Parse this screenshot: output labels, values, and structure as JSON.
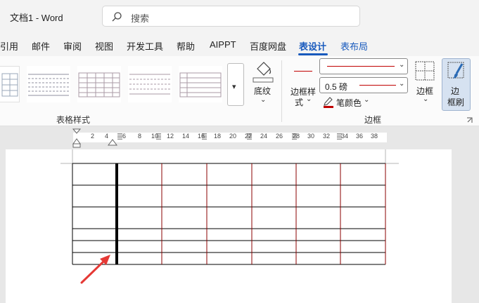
{
  "window": {
    "title": "文档1  -  Word"
  },
  "search": {
    "label": "搜索"
  },
  "tabs": [
    {
      "label": "引用"
    },
    {
      "label": "邮件"
    },
    {
      "label": "审阅"
    },
    {
      "label": "视图"
    },
    {
      "label": "开发工具"
    },
    {
      "label": "帮助"
    },
    {
      "label": "AIPPT"
    },
    {
      "label": "百度网盘"
    },
    {
      "label": "表设计"
    },
    {
      "label": "表布局"
    }
  ],
  "active_tab": "表设计",
  "ribbon": {
    "table_styles_group": "表格样式",
    "shading_label": "底纹",
    "border_style_label_1": "边框样",
    "border_style_label_2": "式",
    "pen_weight": "0.5 磅",
    "pen_color_label": "笔颜色",
    "borders_label": "边框",
    "border_painter_label_1": "边",
    "border_painter_label_2": "框刷",
    "borders_group": "边框",
    "pen_color": "#c00000",
    "accent": "#185abd"
  },
  "ruler": {
    "numbers": [
      "2",
      "4",
      "6",
      "8",
      "10",
      "12",
      "14",
      "16",
      "18",
      "20",
      "22",
      "24",
      "26",
      "28",
      "30",
      "32",
      "34",
      "36",
      "38"
    ]
  },
  "table": {
    "rows": 7,
    "columns": 7,
    "border_color": "#8b0000",
    "thick_border_column": 1
  }
}
